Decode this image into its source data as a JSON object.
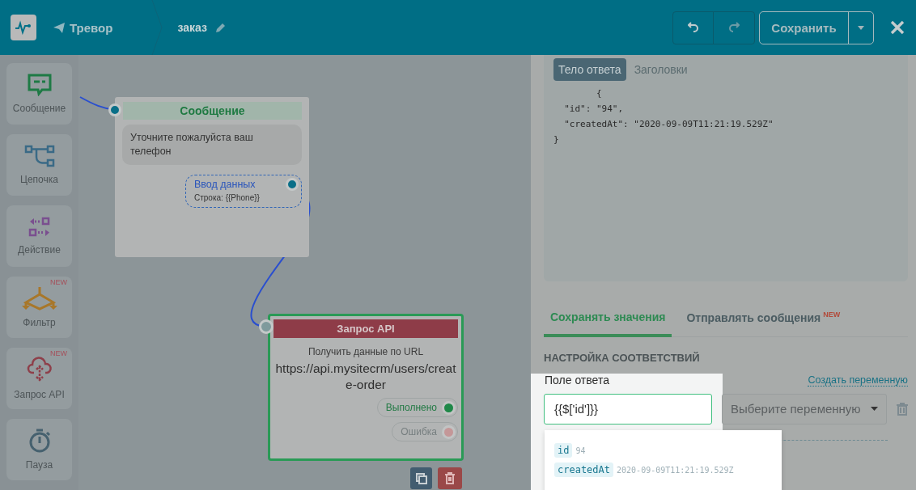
{
  "header": {
    "bot_name": "Тревор",
    "scenario_name": "заказ",
    "history": [
      {
        "kind": "undo",
        "disabled": false
      },
      {
        "kind": "redo",
        "disabled": true
      }
    ],
    "save_button": "Сохранить"
  },
  "sidebar": {
    "items": [
      {
        "label": "Сообщение",
        "kind": "message"
      },
      {
        "label": "Цепочка",
        "kind": "chain"
      },
      {
        "label": "Действие",
        "kind": "action"
      },
      {
        "label": "Фильтр",
        "kind": "filter",
        "badge": "NEW"
      },
      {
        "label": "Запрос API",
        "kind": "api",
        "badge": "NEW"
      },
      {
        "label": "Пауза",
        "kind": "pause"
      }
    ]
  },
  "canvas": {
    "message_node": {
      "title": "Сообщение",
      "text": "Уточните пожалуйста ваш телефон",
      "input": {
        "title": "Ввод данных",
        "value": "Строка: {{Phone}}"
      }
    },
    "api_node": {
      "title": "Запрос API",
      "description": "Получить данные по URL",
      "url": "https://api.mysitecrm/users/create-order",
      "outputs": [
        {
          "label": "Выполнено",
          "kind": "success"
        },
        {
          "label": "Ошибка",
          "kind": "error"
        }
      ]
    }
  },
  "response_panel": {
    "tabs": [
      {
        "label": "Тело ответа",
        "selected": true
      },
      {
        "label": "Заголовки",
        "selected": false
      }
    ],
    "body_lines": [
      "        {",
      "  \"id\": \"94\",",
      "  \"createdAt\": \"2020-09-09T11:21:19.529Z\"",
      "}"
    ]
  },
  "mapping": {
    "tabs": [
      {
        "label": "Сохранять значения",
        "selected": true
      },
      {
        "label": "Отправлять сообщения",
        "selected": false,
        "badge": "NEW"
      }
    ],
    "heading": "НАСТРОЙКА СООТВЕТСТВИЙ",
    "field_label": "Поле ответа",
    "create_link": "Создать переменную",
    "field_value": "{{$['id']}}",
    "variable_placeholder": "Выберите переменную",
    "suggestions": [
      {
        "key": "id",
        "value": "94"
      },
      {
        "key": "createdAt",
        "value": "2020-09-09T11:21:19.529Z"
      }
    ]
  }
}
